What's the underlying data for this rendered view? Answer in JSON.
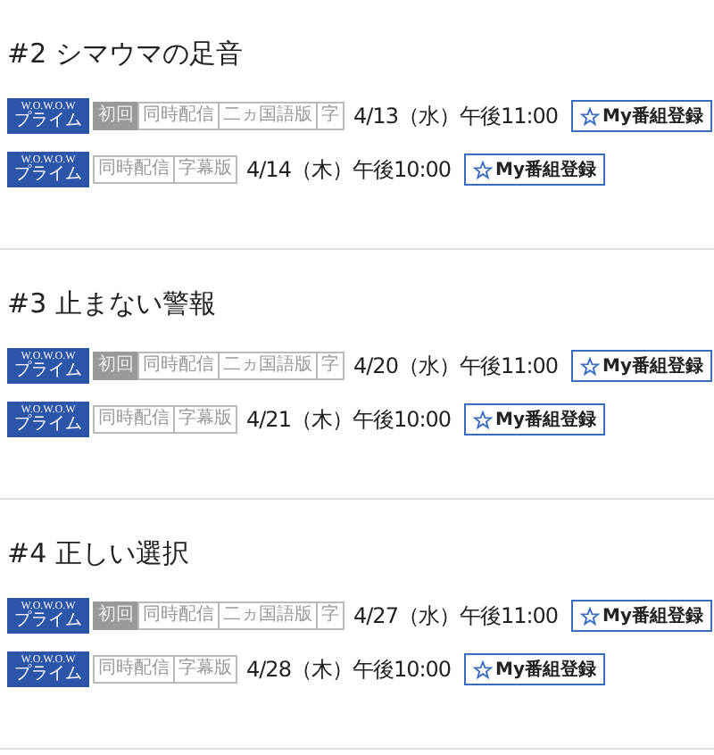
{
  "episodes": [
    {
      "title": "#2 シマウマの足音",
      "airings": [
        {
          "channel": {
            "name": "W.O.W.O.W",
            "sub": "プライム"
          },
          "tags": [
            {
              "label": "初回",
              "kind": "filled"
            },
            {
              "label": "同時配信",
              "kind": "outline"
            },
            {
              "label": "二ヵ国語版",
              "kind": "outline"
            },
            {
              "label": "字",
              "kind": "outline"
            }
          ],
          "datetime": "4/13（水）午後11:00",
          "button": "My番組登録"
        },
        {
          "channel": {
            "name": "W.O.W.O.W",
            "sub": "プライム"
          },
          "tags": [
            {
              "label": "同時配信",
              "kind": "outline"
            },
            {
              "label": "字幕版",
              "kind": "outline"
            }
          ],
          "datetime": "4/14（木）午後10:00",
          "button": "My番組登録"
        }
      ]
    },
    {
      "title": "#3 止まない警報",
      "airings": [
        {
          "channel": {
            "name": "W.O.W.O.W",
            "sub": "プライム"
          },
          "tags": [
            {
              "label": "初回",
              "kind": "filled"
            },
            {
              "label": "同時配信",
              "kind": "outline"
            },
            {
              "label": "二ヵ国語版",
              "kind": "outline"
            },
            {
              "label": "字",
              "kind": "outline"
            }
          ],
          "datetime": "4/20（水）午後11:00",
          "button": "My番組登録"
        },
        {
          "channel": {
            "name": "W.O.W.O.W",
            "sub": "プライム"
          },
          "tags": [
            {
              "label": "同時配信",
              "kind": "outline"
            },
            {
              "label": "字幕版",
              "kind": "outline"
            }
          ],
          "datetime": "4/21（木）午後10:00",
          "button": "My番組登録"
        }
      ]
    },
    {
      "title": "#4 正しい選択",
      "airings": [
        {
          "channel": {
            "name": "W.O.W.O.W",
            "sub": "プライム"
          },
          "tags": [
            {
              "label": "初回",
              "kind": "filled"
            },
            {
              "label": "同時配信",
              "kind": "outline"
            },
            {
              "label": "二ヵ国語版",
              "kind": "outline"
            },
            {
              "label": "字",
              "kind": "outline"
            }
          ],
          "datetime": "4/27（水）午後11:00",
          "button": "My番組登録"
        },
        {
          "channel": {
            "name": "W.O.W.O.W",
            "sub": "プライム"
          },
          "tags": [
            {
              "label": "同時配信",
              "kind": "outline"
            },
            {
              "label": "字幕版",
              "kind": "outline"
            }
          ],
          "datetime": "4/28（木）午後10:00",
          "button": "My番組登録"
        }
      ]
    }
  ]
}
